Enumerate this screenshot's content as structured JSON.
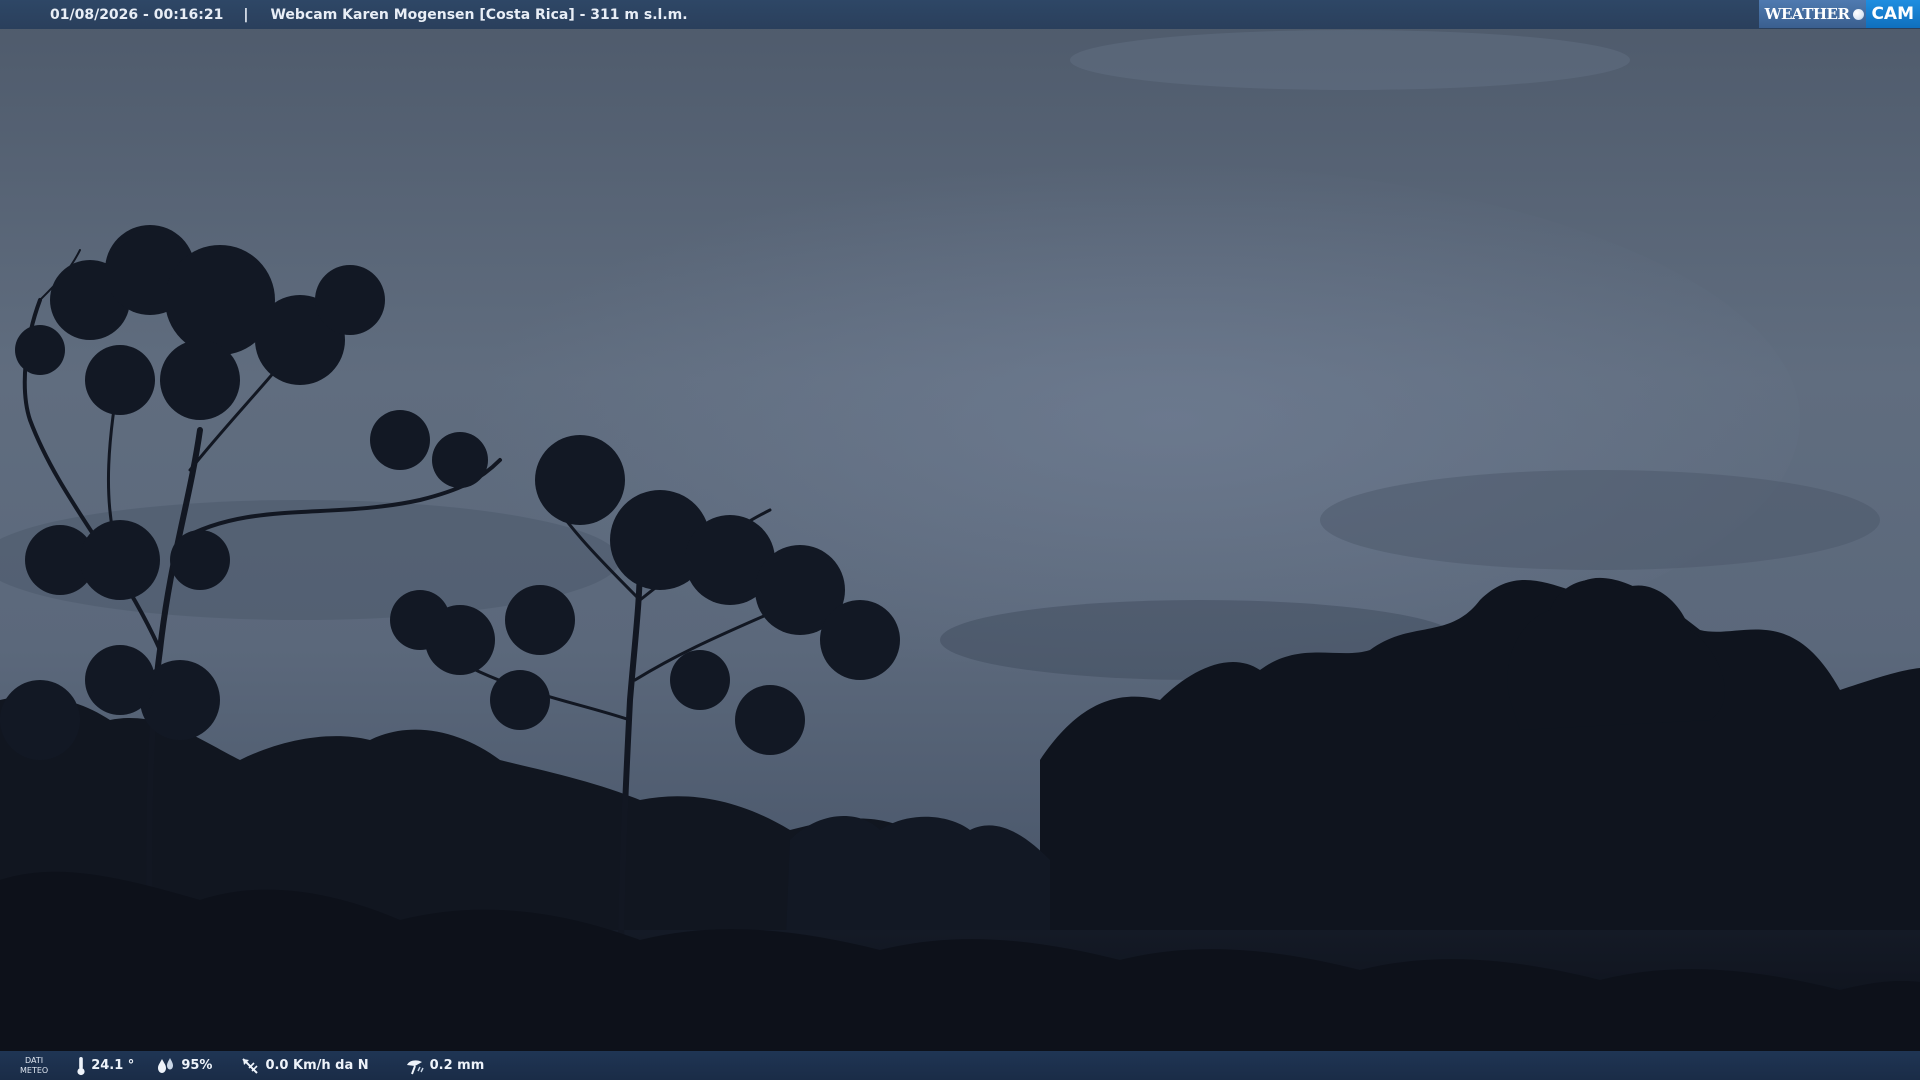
{
  "header": {
    "datetime": "01/08/2026 - 00:16:21",
    "separator": "|",
    "title": "Webcam Karen Mogensen [Costa Rica]  - 311 m s.l.m."
  },
  "logo": {
    "part1": "WEATHER",
    "part2": "CAM"
  },
  "footer": {
    "dati_line1": "DATI",
    "dati_line2": "METEO",
    "temperature": "24.1 °",
    "humidity": "95%",
    "wind": "0.0 Km/h da N",
    "rain": "0.2 mm"
  },
  "icons": {
    "temperature": "thermometer-icon",
    "humidity": "humidity-drops-icon",
    "wind": "wind-vane-icon",
    "rain": "rain-gauge-icon"
  },
  "colors": {
    "top_bar": "#2e4766",
    "bottom_bar": "#1f3554",
    "logo_cam": "#1f8ee0",
    "sky": "#5d6a7c",
    "foliage": "#0c1018"
  }
}
